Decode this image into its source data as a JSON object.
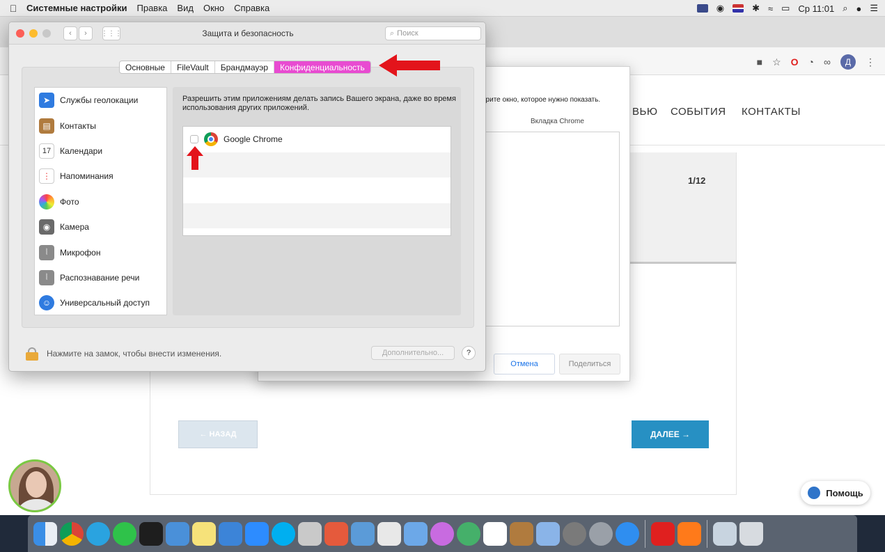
{
  "menubar": {
    "app_name": "Системные настройки",
    "menus": [
      "Правка",
      "Вид",
      "Окно",
      "Справка"
    ],
    "clock": "Ср 11:01"
  },
  "browser": {
    "nav_items": [
      "ВЬЮ",
      "СОБЫТИЯ",
      "КОНТАКТЫ"
    ],
    "counter": "1/12",
    "back_label": "← НАЗАД",
    "next_label": "ДАЛЕЕ →",
    "help_label": "Помощь",
    "profile_initial": "Д"
  },
  "share_dialog": {
    "prompt": "ерите окно, которое нужно показать.",
    "tab_label": "Вкладка Chrome",
    "cancel_label": "Отмена",
    "share_label": "Поделиться"
  },
  "prefs": {
    "title": "Защита и безопасность",
    "search_placeholder": "Поиск",
    "tabs": [
      {
        "label": "Основные",
        "active": false
      },
      {
        "label": "FileVault",
        "active": false
      },
      {
        "label": "Брандмауэр",
        "active": false
      },
      {
        "label": "Конфиденциальность",
        "active": true
      }
    ],
    "sidebar": [
      {
        "label": "Службы геолокации",
        "icon": "location-icon",
        "color": "#2f7be0"
      },
      {
        "label": "Контакты",
        "icon": "contacts-icon",
        "color": "#b07b3e"
      },
      {
        "label": "Календари",
        "icon": "calendar-icon",
        "color": "#ffffff"
      },
      {
        "label": "Напоминания",
        "icon": "reminders-icon",
        "color": "#ffffff"
      },
      {
        "label": "Фото",
        "icon": "photos-icon",
        "color": "#f0a030"
      },
      {
        "label": "Камера",
        "icon": "camera-icon",
        "color": "#6a6a6a"
      },
      {
        "label": "Микрофон",
        "icon": "microphone-icon",
        "color": "#8a8a8a"
      },
      {
        "label": "Распознавание речи",
        "icon": "speech-icon",
        "color": "#8a8a8a"
      },
      {
        "label": "Универсальный доступ",
        "icon": "accessibility-icon",
        "color": "#2f7be0"
      }
    ],
    "description": "Разрешить этим приложениям делать запись Вашего экрана, даже во время использования других приложений.",
    "apps": [
      {
        "name": "Google Chrome",
        "checked": false
      }
    ],
    "lock_text": "Нажмите на замок, чтобы внести изменения.",
    "advanced_label": "Дополнительно...",
    "help_label": "?"
  },
  "colors": {
    "accent_tab": "#e84bd1",
    "arrow": "#e3141b",
    "next_button": "#2790c3"
  }
}
